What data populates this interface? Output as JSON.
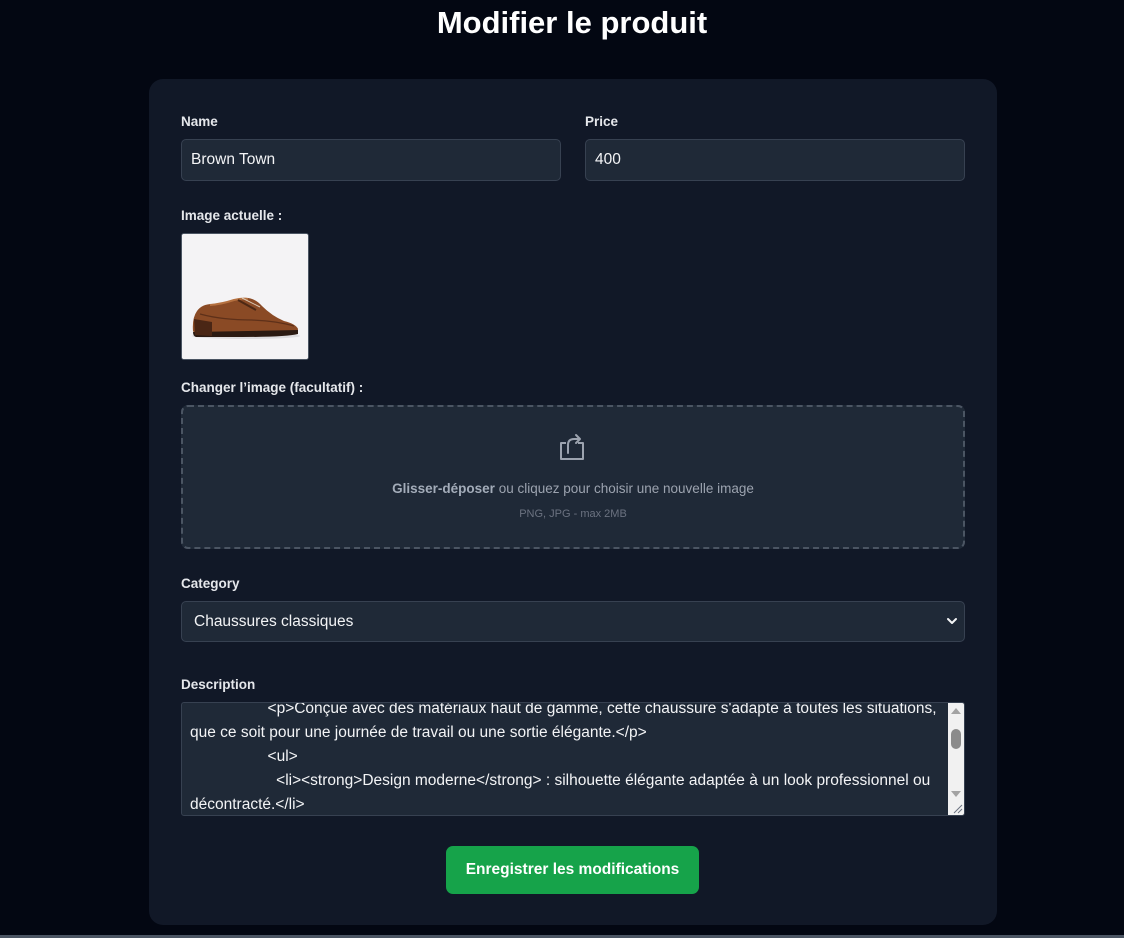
{
  "page": {
    "title": "Modifier le produit"
  },
  "form": {
    "name": {
      "label": "Name",
      "value": "Brown Town"
    },
    "price": {
      "label": "Price",
      "value": "400"
    },
    "current_image": {
      "label": "Image actuelle :",
      "icon": "brown-leather-shoe-image"
    },
    "change_image": {
      "label": "Changer l’image (facultatif) :",
      "icon": "upload-icon",
      "text_bold": "Glisser-déposer",
      "text_rest": " ou cliquez pour choisir une nouvelle image",
      "hint": "PNG, JPG - max 2MB"
    },
    "category": {
      "label": "Category",
      "selected": "Chaussures classiques"
    },
    "description": {
      "label": "Description",
      "content": "                  <p>Conçue avec des matériaux haut de gamme, cette chaussure s'adapte à toutes les situations, que ce soit pour une journée de travail ou une sortie élégante.</p>\n                  <ul>\n                    <li><strong>Design moderne</strong> : silhouette élégante adaptée à un look professionnel ou décontracté.</li>"
    },
    "submit_label": "Enregistrer les modifications"
  },
  "colors": {
    "accent": "#16a34a",
    "card": "#111827",
    "background": "#030712"
  }
}
